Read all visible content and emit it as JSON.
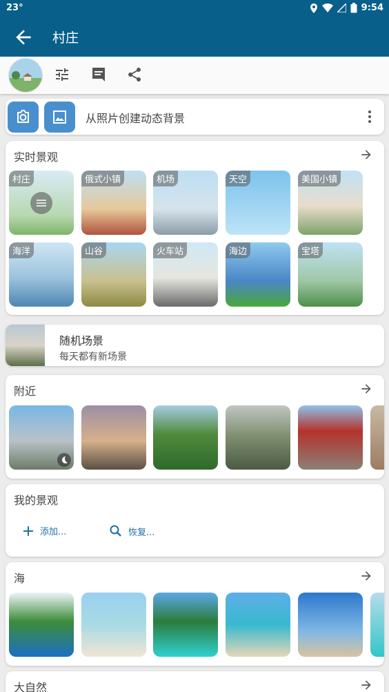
{
  "status": {
    "left": "23°",
    "time": "9:54"
  },
  "appbar": {
    "title": "村庄"
  },
  "photo": {
    "text": "从照片创建动态背景"
  },
  "live": {
    "title": "实时景观",
    "items": [
      {
        "label": "村庄"
      },
      {
        "label": "俄式小镇"
      },
      {
        "label": "机场"
      },
      {
        "label": "天空"
      },
      {
        "label": "美国小镇"
      },
      {
        "label": "海洋"
      },
      {
        "label": "山谷"
      },
      {
        "label": "火车站"
      },
      {
        "label": "海边"
      },
      {
        "label": "宝塔"
      }
    ]
  },
  "random": {
    "title": "随机场景",
    "subtitle": "每天都有新场景"
  },
  "nearby": {
    "title": "附近"
  },
  "mine": {
    "title": "我的景观",
    "add": "添加...",
    "restore": "恢复..."
  },
  "sea": {
    "title": "海"
  },
  "nature": {
    "title": "大自然"
  }
}
